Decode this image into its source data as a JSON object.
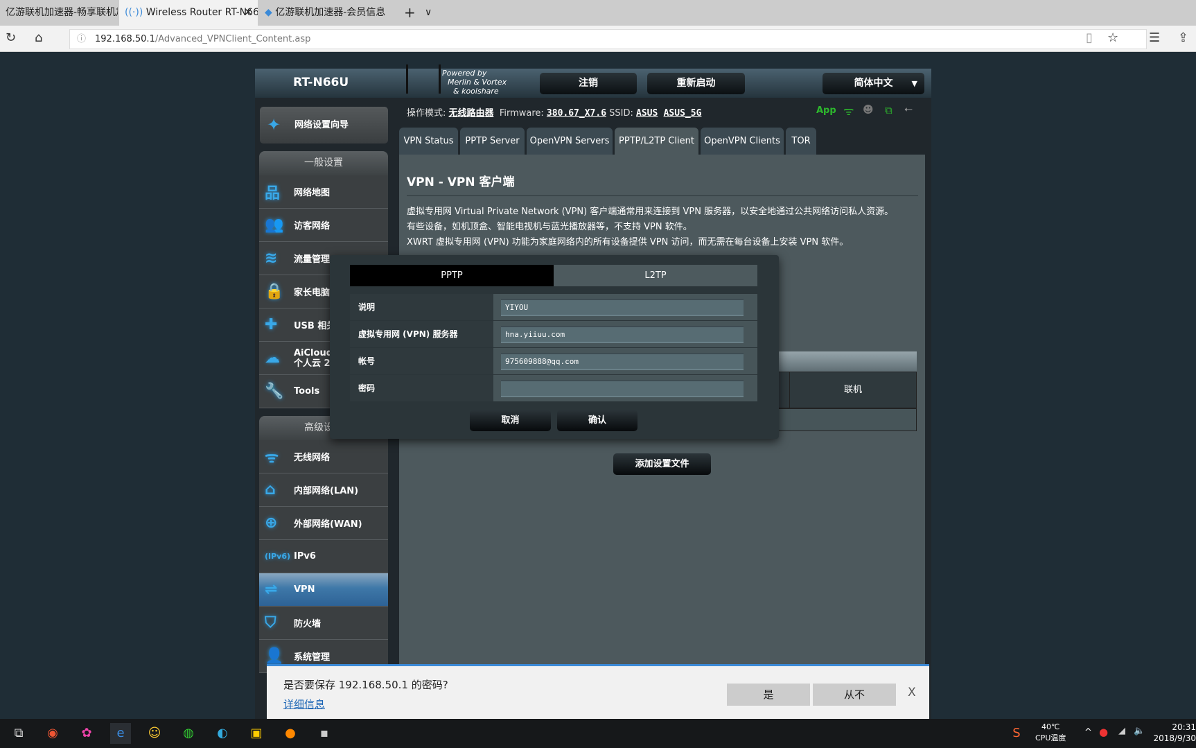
{
  "browser": {
    "tabs": [
      {
        "label": "亿游联机加速器-畅享联机加"
      },
      {
        "label": "Wireless Router RT-N66"
      },
      {
        "label": "亿游联机加速器-会员信息"
      }
    ],
    "new_tab": "+",
    "tab_list": "∨",
    "close": "✕",
    "url_host": "192.168.50.1",
    "url_path": "/Advanced_VPNClient_Content.asp"
  },
  "router": {
    "model": "RT-N66U",
    "powered": "Powered by",
    "powered2": "Merlin & Vortex",
    "powered3": "& koolshare",
    "logout": "注销",
    "reboot": "重新启动",
    "language": "简体中文",
    "mode_label": "操作模式:",
    "mode": "无线路由器",
    "fw_label": "Firmware:",
    "fw": "380.67_X7.6",
    "ssid_label": "SSID:",
    "ssid1": "ASUS",
    "ssid2": "ASUS_5G",
    "app": "App"
  },
  "sidebar": {
    "quick": "网络设置向导",
    "general": "一般设置",
    "general_items": [
      {
        "label": "网络地图",
        "icon": "network-map-icon"
      },
      {
        "label": "访客网络",
        "icon": "guest-icon"
      },
      {
        "label": "流量管理",
        "icon": "traffic-icon"
      },
      {
        "label": "家长电脑",
        "icon": "lock-icon"
      },
      {
        "label": "USB 相关",
        "icon": "puzzle-icon"
      },
      {
        "label": "AiCloud",
        "label2": "个人云 2",
        "icon": "cloud-icon"
      },
      {
        "label": "Tools",
        "icon": "wrench-icon"
      }
    ],
    "advanced": "高级设置",
    "advanced_items": [
      {
        "label": "无线网络"
      },
      {
        "label": "内部网络(LAN)"
      },
      {
        "label": "外部网络(WAN)"
      },
      {
        "label": "IPv6"
      },
      {
        "label": "VPN"
      },
      {
        "label": "防火墙"
      },
      {
        "label": "系统管理"
      }
    ]
  },
  "tabs": [
    "VPN Status",
    "PPTP Server",
    "OpenVPN Servers",
    "PPTP/L2TP Client",
    "OpenVPN Clients",
    "TOR"
  ],
  "content": {
    "title": "VPN - VPN 客户端",
    "lines": [
      "虚拟专用网 Virtual Private Network (VPN) 客户端通常用来连接到 VPN 服务器，以安全地通过公共网络访问私人资源。",
      "有些设备，如机顶盒、智能电视机与蓝光播放器等，不支持 VPN 软件。",
      "XWRT 虚拟专用网 (VPN) 功能为家庭网络内的所有设备提供 VPN 访问，而无需在每台设备上安装 VPN 软件。"
    ],
    "col_connect": "联机",
    "add_profile": "添加设置文件"
  },
  "dialog": {
    "tab_pptp": "PPTP",
    "tab_l2tp": "L2TP",
    "fields": [
      {
        "label": "说明",
        "value": "YIYOU"
      },
      {
        "label": "虚拟专用网 (VPN) 服务器",
        "value": "hna.yiiuu.com"
      },
      {
        "label": "帐号",
        "value": "975609888@qq.com"
      },
      {
        "label": "密码",
        "value": ""
      }
    ],
    "cancel": "取消",
    "ok": "确认"
  },
  "savebar": {
    "question": "是否要保存 192.168.50.1 的密码?",
    "details": "详细信息",
    "yes": "是",
    "never": "从不",
    "close": "X"
  },
  "taskbar": {
    "temp": "40℃",
    "temp_label": "CPU温度",
    "time": "20:31",
    "date": "2018/9/30"
  }
}
